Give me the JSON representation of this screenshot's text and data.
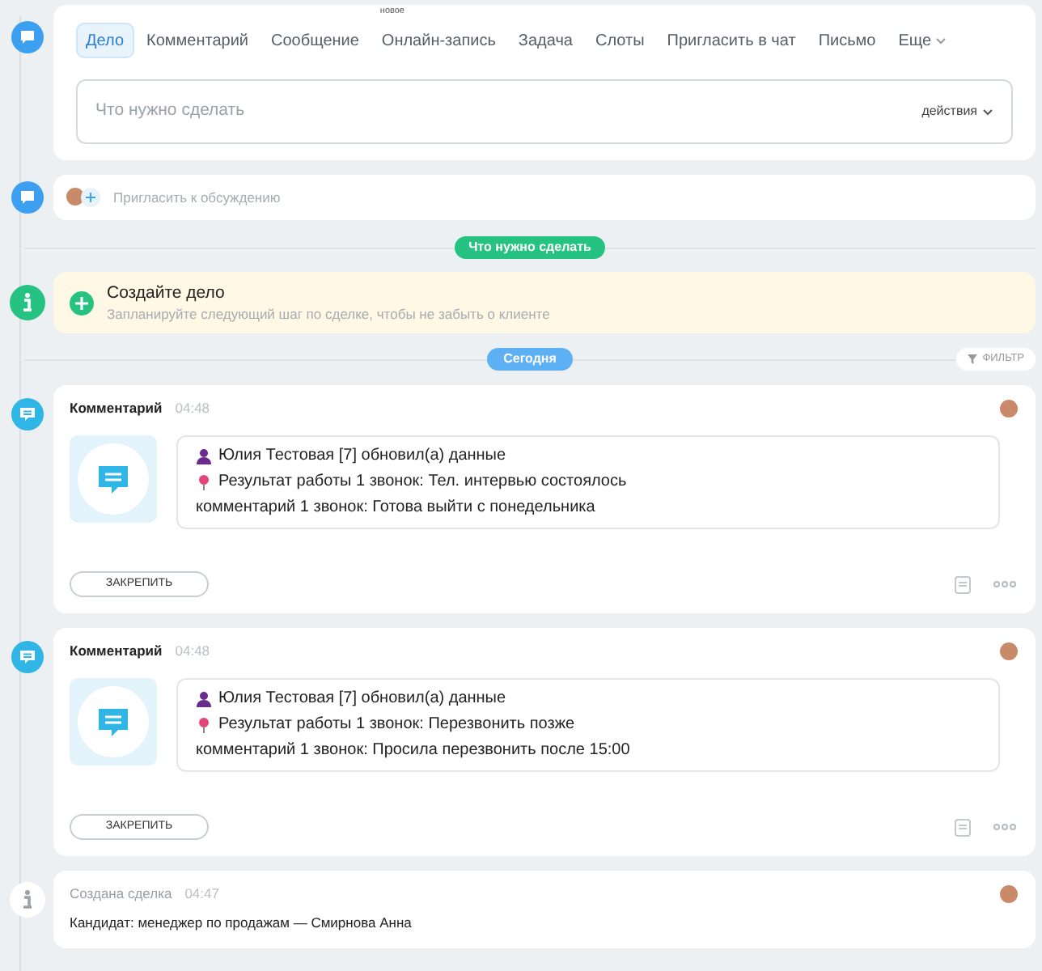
{
  "composer": {
    "tabs": [
      {
        "label": "Дело",
        "selected": true
      },
      {
        "label": "Комментарий",
        "selected": false
      },
      {
        "label": "Сообщение",
        "selected": false
      },
      {
        "label": "Онлайн-запись",
        "selected": false,
        "badge": "новое"
      },
      {
        "label": "Задача",
        "selected": false
      },
      {
        "label": "Слоты",
        "selected": false
      },
      {
        "label": "Пригласить в чат",
        "selected": false
      },
      {
        "label": "Письмо",
        "selected": false
      },
      {
        "label": "Еще",
        "selected": false,
        "dropdown": true
      }
    ],
    "placeholder": "Что нужно сделать",
    "actions": "действия"
  },
  "invite": {
    "placeholder": "Пригласить к обсуждению"
  },
  "todo_divider": "Что нужно сделать",
  "create_task": {
    "title": "Создайте дело",
    "subtitle": "Запланируйте следующий шаг по сделке, чтобы не забыть о клиенте"
  },
  "today_divider": "Сегодня",
  "filter": "ФИЛЬТР",
  "events": [
    {
      "kind": "comment",
      "title": "Комментарий",
      "time": "04:48",
      "lines": [
        {
          "kind": "person",
          "text": "Юлия Тестовая [7] обновил(а) данные"
        },
        {
          "kind": "pin",
          "text": "Результат работы 1 звонок: Тел. интервью состоялось"
        },
        {
          "kind": "plain",
          "text": "комментарий 1 звонок: Готова выйти с понедельника"
        }
      ],
      "pin_button": "ЗАКРЕПИТЬ"
    },
    {
      "kind": "comment",
      "title": "Комментарий",
      "time": "04:48",
      "lines": [
        {
          "kind": "person",
          "text": "Юлия Тестовая [7] обновил(а) данные"
        },
        {
          "kind": "pin",
          "text": "Результат работы 1 звонок: Перезвонить позже"
        },
        {
          "kind": "plain",
          "text": "комментарий 1 звонок: Просила перезвонить после 15:00"
        }
      ],
      "pin_button": "ЗАКРЕПИТЬ"
    },
    {
      "kind": "info",
      "title": "Создана сделка",
      "time": "04:47",
      "text": "Кандидат: менеджер по продажам — Смирнова Анна"
    }
  ]
}
